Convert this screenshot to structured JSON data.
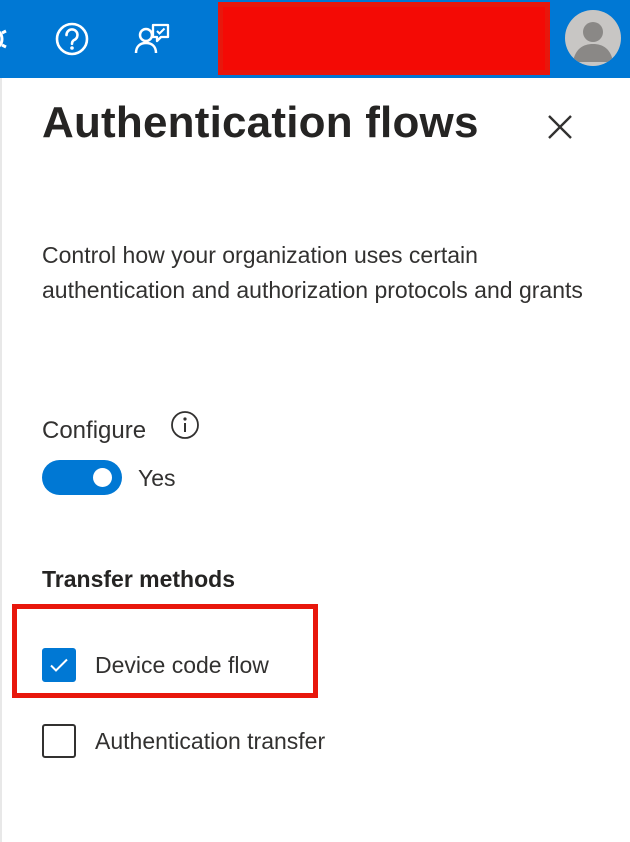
{
  "topbar": {
    "icons": [
      "gear-icon",
      "help-icon",
      "feedback-icon",
      "avatar-icon"
    ],
    "redacted_color": "#f40a05",
    "background": "#0078d4"
  },
  "panel": {
    "title": "Authentication flows",
    "description": "Control how your organization uses certain authentication and authorization protocols and grants",
    "configure": {
      "label": "Configure",
      "toggle_value": "Yes",
      "enabled": true
    },
    "transfer_methods": {
      "heading": "Transfer methods",
      "options": [
        {
          "label": "Device code flow",
          "checked": true
        },
        {
          "label": "Authentication transfer",
          "checked": false
        }
      ]
    }
  },
  "colors": {
    "accent": "#0078d4",
    "highlight": "#e8170c"
  }
}
